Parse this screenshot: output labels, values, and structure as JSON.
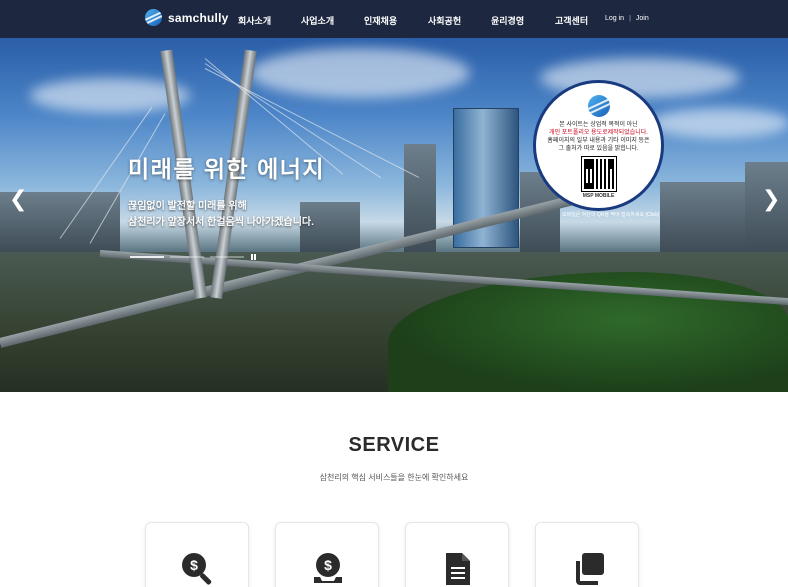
{
  "header": {
    "brand": "samchully",
    "nav": [
      {
        "label": "회사소개"
      },
      {
        "label": "사업소개"
      },
      {
        "label": "인재채용"
      },
      {
        "label": "사회공헌"
      },
      {
        "label": "윤리경영"
      },
      {
        "label": "고객센터"
      }
    ],
    "login": "Log in",
    "join": "Join"
  },
  "hero": {
    "title": "미래를 위한 에너지",
    "subtitle_line1": "끊임없이 발전할 미래를 위해",
    "subtitle_line2": "삼천리가 앞장서서 한걸음씩 나아가겠습니다.",
    "prev_icon": "chevron-left-icon",
    "next_icon": "chevron-right-icon"
  },
  "badge": {
    "line1": "본 사이트는 상업적 목적이 아닌",
    "line2": "개인 포트폴리오 용도로제작되었습니다.",
    "line3": "홈페이지의 일부 내용과 기타 이미지 등은",
    "line4": "그 출처가 따로 있음을 밝힙니다.",
    "qr_label": "MSP MOBILE",
    "footer": "모바일은 하단의 QR을 찍어 접속하세요 [Click]"
  },
  "service": {
    "title": "SERVICE",
    "subtitle": "삼천리의 핵심 서비스들을 한눈에 확인하세요",
    "cards": [
      {
        "icon": "dollar-search-icon"
      },
      {
        "icon": "dollar-coin-icon"
      },
      {
        "icon": "document-icon"
      },
      {
        "icon": "copy-icon"
      }
    ]
  },
  "colors": {
    "header_bg": "#0a1630",
    "accent": "#1a5fb4",
    "icon": "#2b2b2b"
  }
}
